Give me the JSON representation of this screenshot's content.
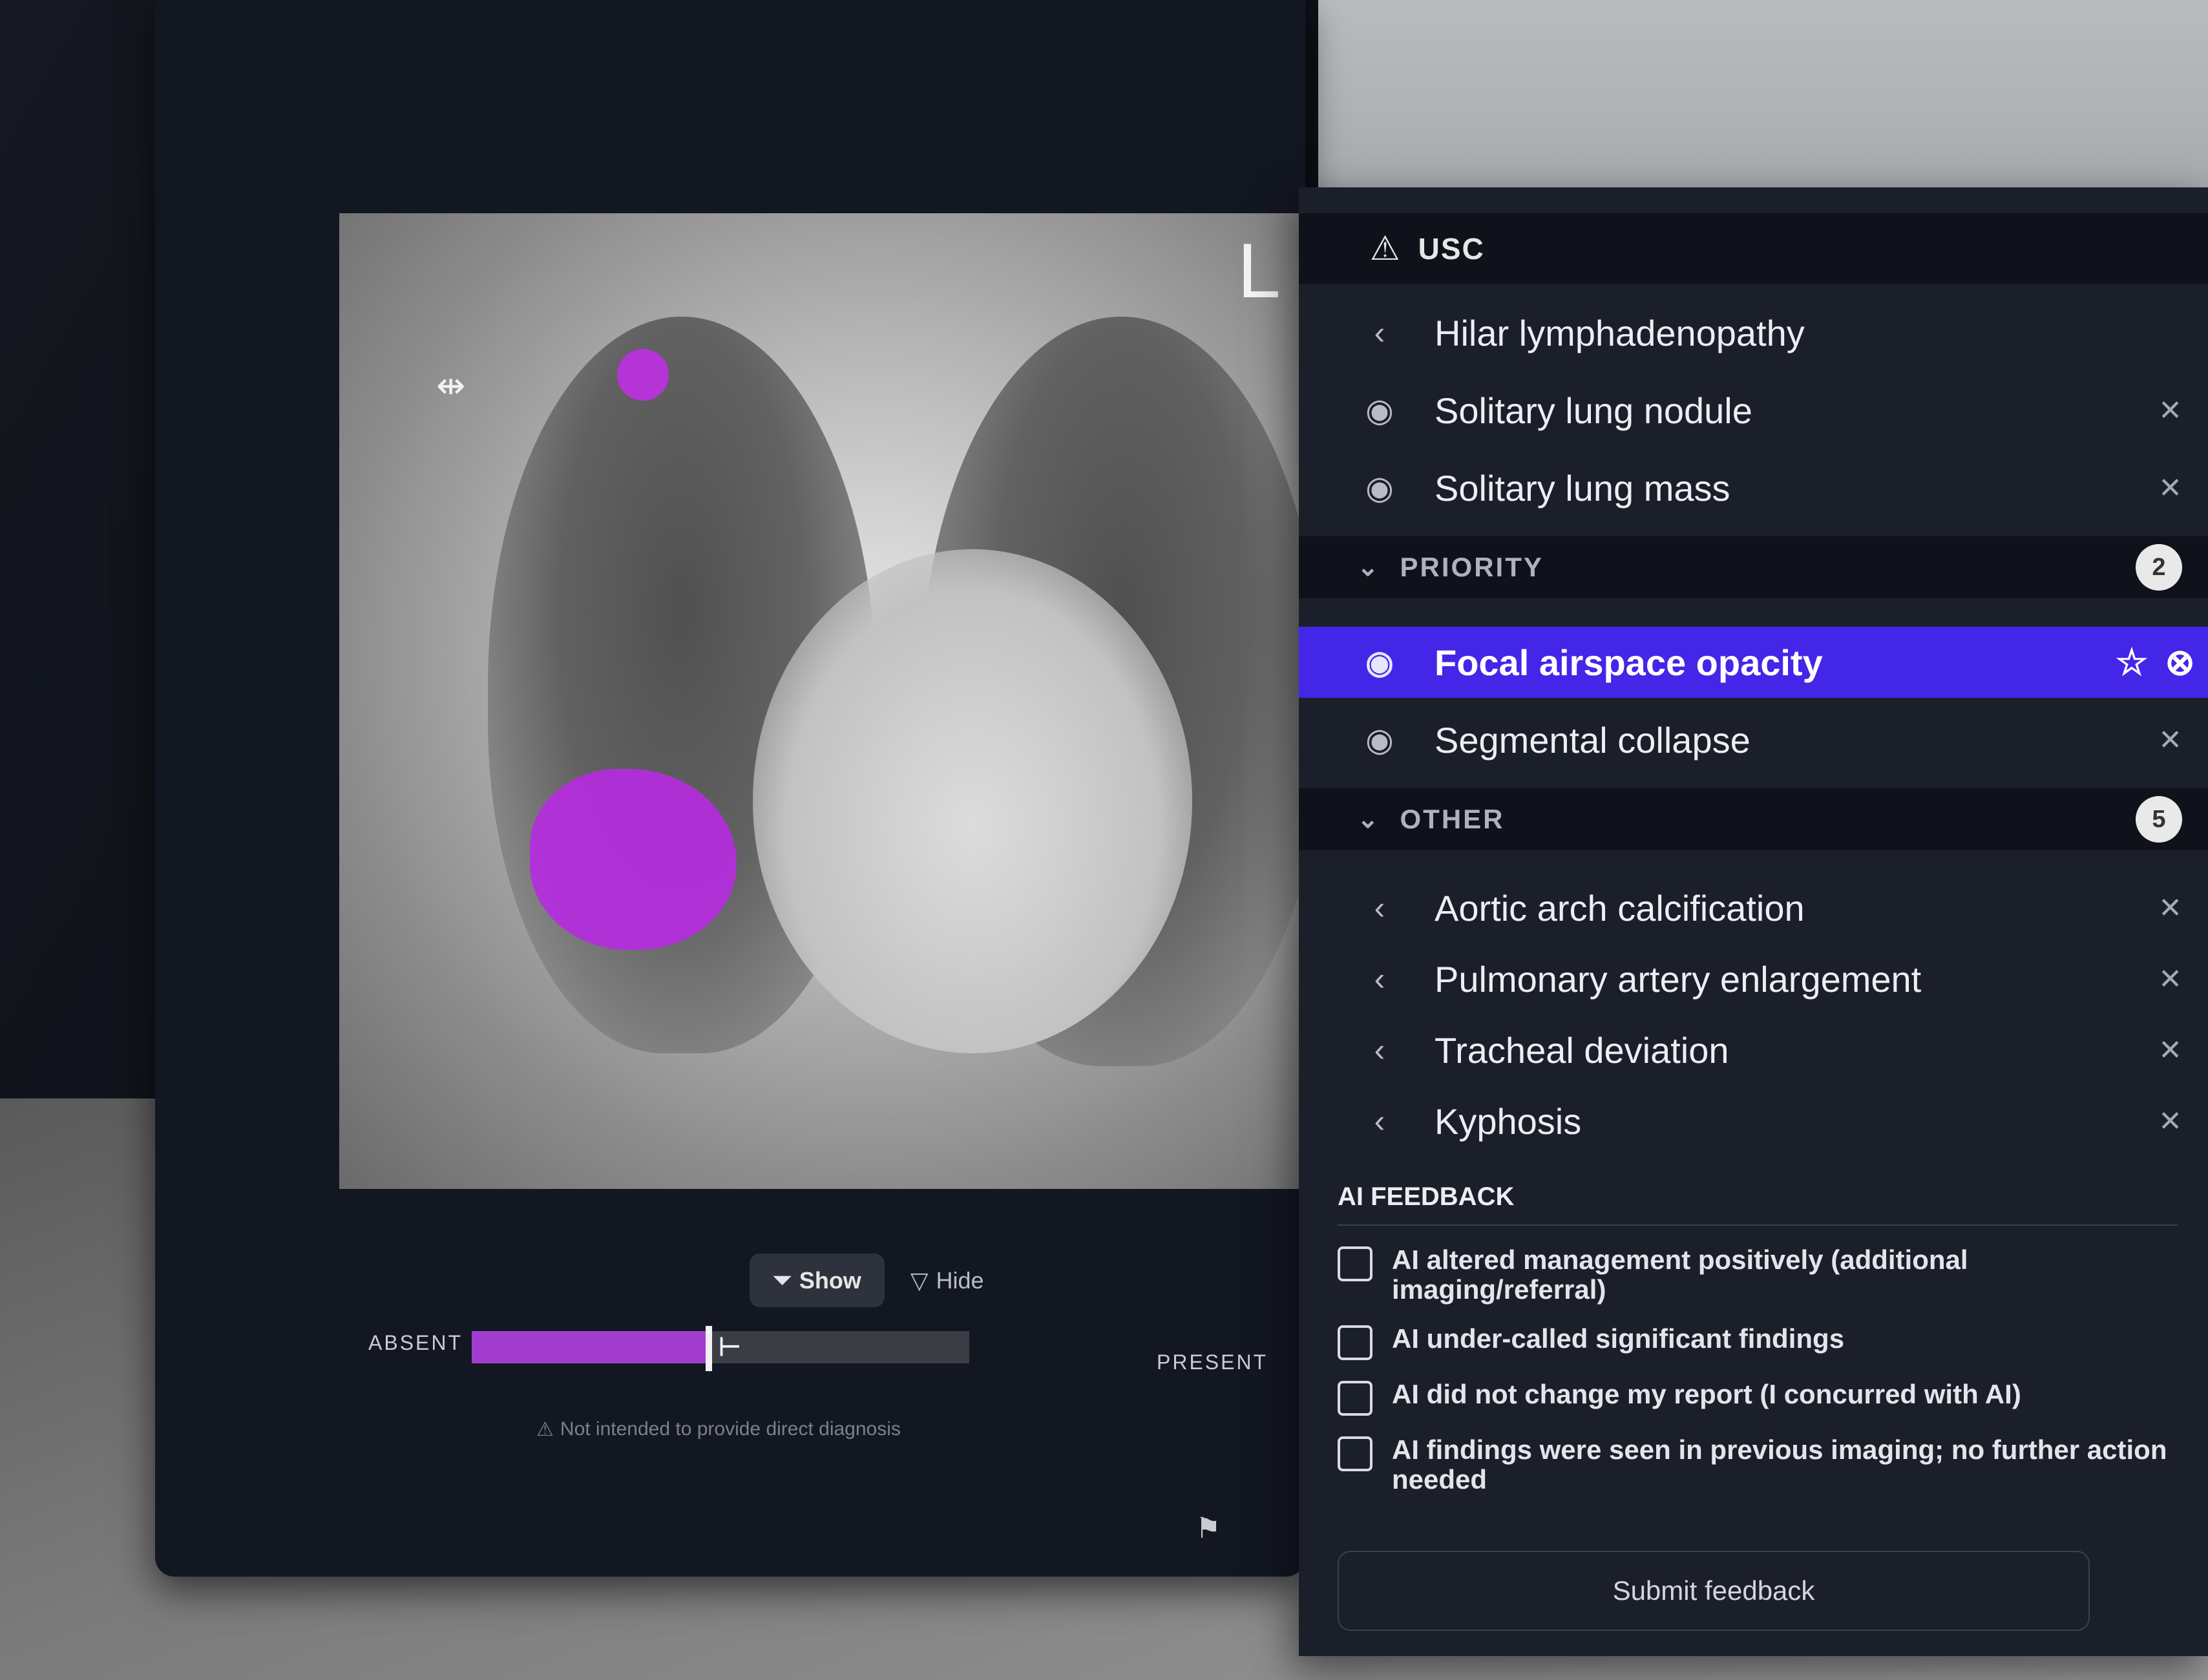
{
  "viewer": {
    "side_marker": "L",
    "show_label": "Show",
    "hide_label": "Hide",
    "absent_label": "ABSENT",
    "present_label": "PRESENT",
    "slider_level_pct": 47,
    "disclaimer": "Not intended to provide direct diagnosis",
    "overlay_color": "#b52ce0"
  },
  "panel": {
    "header_title": "USC",
    "top_findings": [
      {
        "label": "Hilar lymphadenopathy",
        "icon": "chevron-left-icon"
      },
      {
        "label": "Solitary lung nodule",
        "icon": "eye-icon"
      },
      {
        "label": "Solitary lung mass",
        "icon": "eye-icon"
      }
    ],
    "priority": {
      "title": "PRIORITY",
      "count": "2",
      "items": [
        {
          "label": "Focal airspace opacity",
          "icon": "eye-icon",
          "active": true
        },
        {
          "label": "Segmental collapse",
          "icon": "eye-icon"
        }
      ]
    },
    "other": {
      "title": "OTHER",
      "count": "5",
      "items": [
        {
          "label": "Aortic arch calcification",
          "icon": "chevron-left-icon"
        },
        {
          "label": "Pulmonary artery enlargement",
          "icon": "chevron-left-icon"
        },
        {
          "label": "Tracheal deviation",
          "icon": "chevron-left-icon"
        },
        {
          "label": "Kyphosis",
          "icon": "chevron-left-icon"
        }
      ]
    },
    "feedback": {
      "title": "AI FEEDBACK",
      "options": [
        "AI altered management positively (additional imaging/referral)",
        "AI under-called significant findings",
        "AI did not change my report (I concurred with AI)",
        "AI findings were seen in previous imaging; no further action needed"
      ],
      "submit_label": "Submit feedback"
    },
    "accent_color": "#4326e8"
  }
}
